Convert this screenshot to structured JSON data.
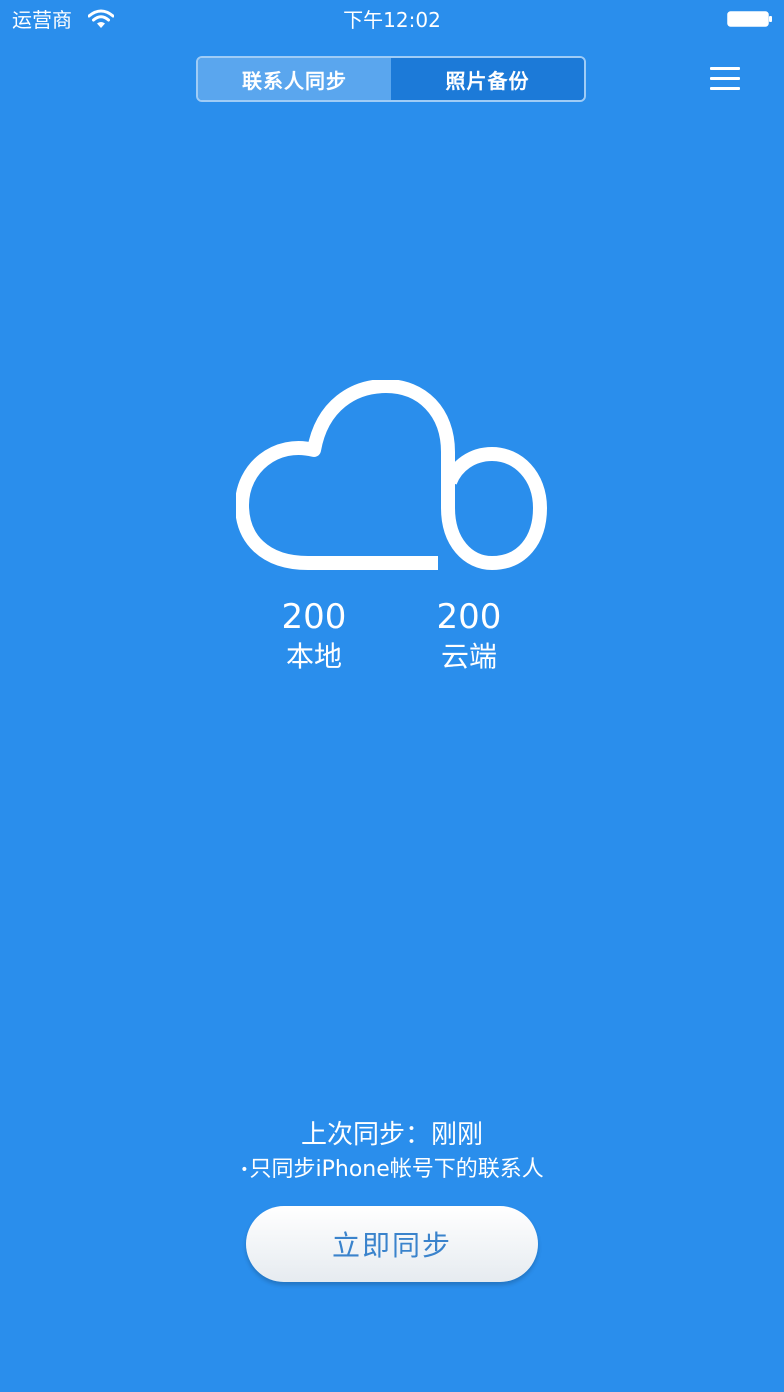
{
  "status_bar": {
    "carrier": "运营商",
    "time": "下午12:02"
  },
  "tabs": [
    {
      "label": "联系人同步",
      "active": true
    },
    {
      "label": "照片备份",
      "active": false
    }
  ],
  "stats": {
    "local": {
      "count": "200",
      "label": "本地"
    },
    "cloud": {
      "count": "200",
      "label": "云端"
    }
  },
  "sync_info": {
    "last_sync": "上次同步：刚刚",
    "note_bullet": "•",
    "note": "只同步iPhone帐号下的联系人"
  },
  "sync_button": {
    "label": "立即同步"
  },
  "icons": {
    "menu": "menu-icon",
    "cloud": "cloud-icon",
    "wifi": "wifi-icon",
    "battery": "battery-icon"
  },
  "colors": {
    "background": "#2a8eec",
    "tab_active": "#5aa6ee",
    "tab_inactive": "#1c7ad8",
    "button_text": "#3a83cc"
  }
}
